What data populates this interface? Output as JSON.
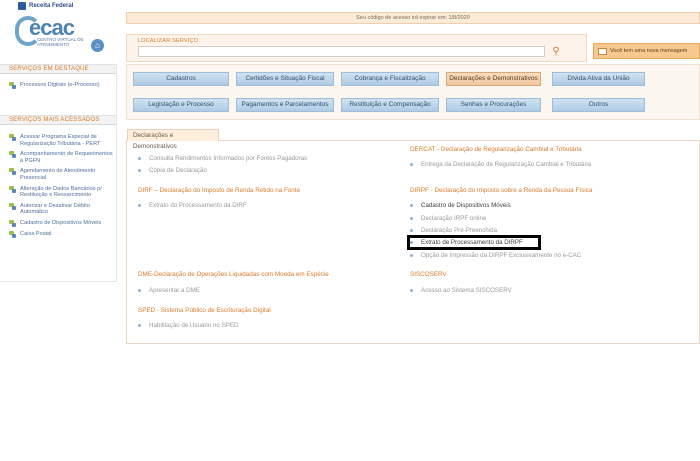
{
  "header": {
    "brand": "Receita Federal",
    "logo_word": "ecac",
    "logo_sub": "CENTRO VIRTUAL DE ATENDIMENTO",
    "home_icon": "home-icon",
    "session_notice": "Seu código de acesso irá expirar em: 1/8/2020"
  },
  "search": {
    "label": "LOCALIZAR SERVIÇO",
    "placeholder": "",
    "button_icon": "search-icon"
  },
  "messages": {
    "label": "Você tem uma nova mensagem",
    "icon": "envelope-icon"
  },
  "sidebar": {
    "highlight_title": "SERVIÇOS EM DESTAQUE",
    "highlight_items": [
      {
        "label": "Processos Digitais (e-Processo)"
      }
    ],
    "most_used_title": "SERVIÇOS MAIS ACESSADOS",
    "most_used_items": [
      {
        "label": "Acessar Programa Especial de Regularização Tributária - PERT"
      },
      {
        "label": "Acompanhamento de Requerimentos à PGFN"
      },
      {
        "label": "Agendamento de Atendimento Presencial"
      },
      {
        "label": "Alteração de Dados Bancários p/ Restituição e Ressarcimento"
      },
      {
        "label": "Autorizar e Desativar Débito Automático"
      },
      {
        "label": "Cadastro de Dispositivos Móveis"
      },
      {
        "label": "Caixa Postal"
      }
    ]
  },
  "categories": [
    {
      "label": "Cadastros"
    },
    {
      "label": "Certidões e Situação Fiscal"
    },
    {
      "label": "Cobrança e Fiscalização"
    },
    {
      "label": "Declarações e Demonstrativos"
    },
    {
      "label": "Dívida Ativa da União"
    },
    {
      "label": "Legislação e Processo"
    },
    {
      "label": "Pagamentos e Parcelamentos"
    },
    {
      "label": "Restituição e Compensação"
    },
    {
      "label": "Senhas e Procurações"
    },
    {
      "label": "Outros"
    }
  ],
  "active_category": "Declarações e Demonstrativos",
  "content": {
    "tab_label": "Declarações e Demonstrativos",
    "sections": [
      {
        "title": "",
        "links": [
          "Consulta Rendimentos Informados por Fontes Pagadoras",
          "Cópia de Declaração"
        ]
      },
      {
        "title": "DERCAT - Declaração de Regularização Cambial e Tributária",
        "links": [
          "Entrega da Declaração de Regularização Cambial e Tributária"
        ]
      },
      {
        "title": "DIRF – Declaração do Imposto de Renda Retido na Fonte",
        "links": [
          "Extrato do Processamento da DIRF"
        ]
      },
      {
        "title": "DIRPF - Declaração do Imposto sobre a Renda da Pessoa Física",
        "links": [
          "Cadastro de Dispositivos Móveis",
          "Declaração IRPF online",
          "Declaração Pré-Preenchida",
          "Extrato de Processamento da DIRPF",
          "Opção de Impressão da DIRPF Exclusivamente no e-CAC"
        ]
      },
      {
        "title": "DME-Declaração de Operações Liquidadas com Moeda em Espécie",
        "links": [
          "Apresentar a DME"
        ]
      },
      {
        "title": "SISCOSERV",
        "links": [
          "Acesso ao Sistema SISCOSERV"
        ]
      },
      {
        "title": "SPED - Sistema Público de Escrituração Digital",
        "links": [
          "Habilitação de Usuário no SPED"
        ]
      }
    ]
  }
}
